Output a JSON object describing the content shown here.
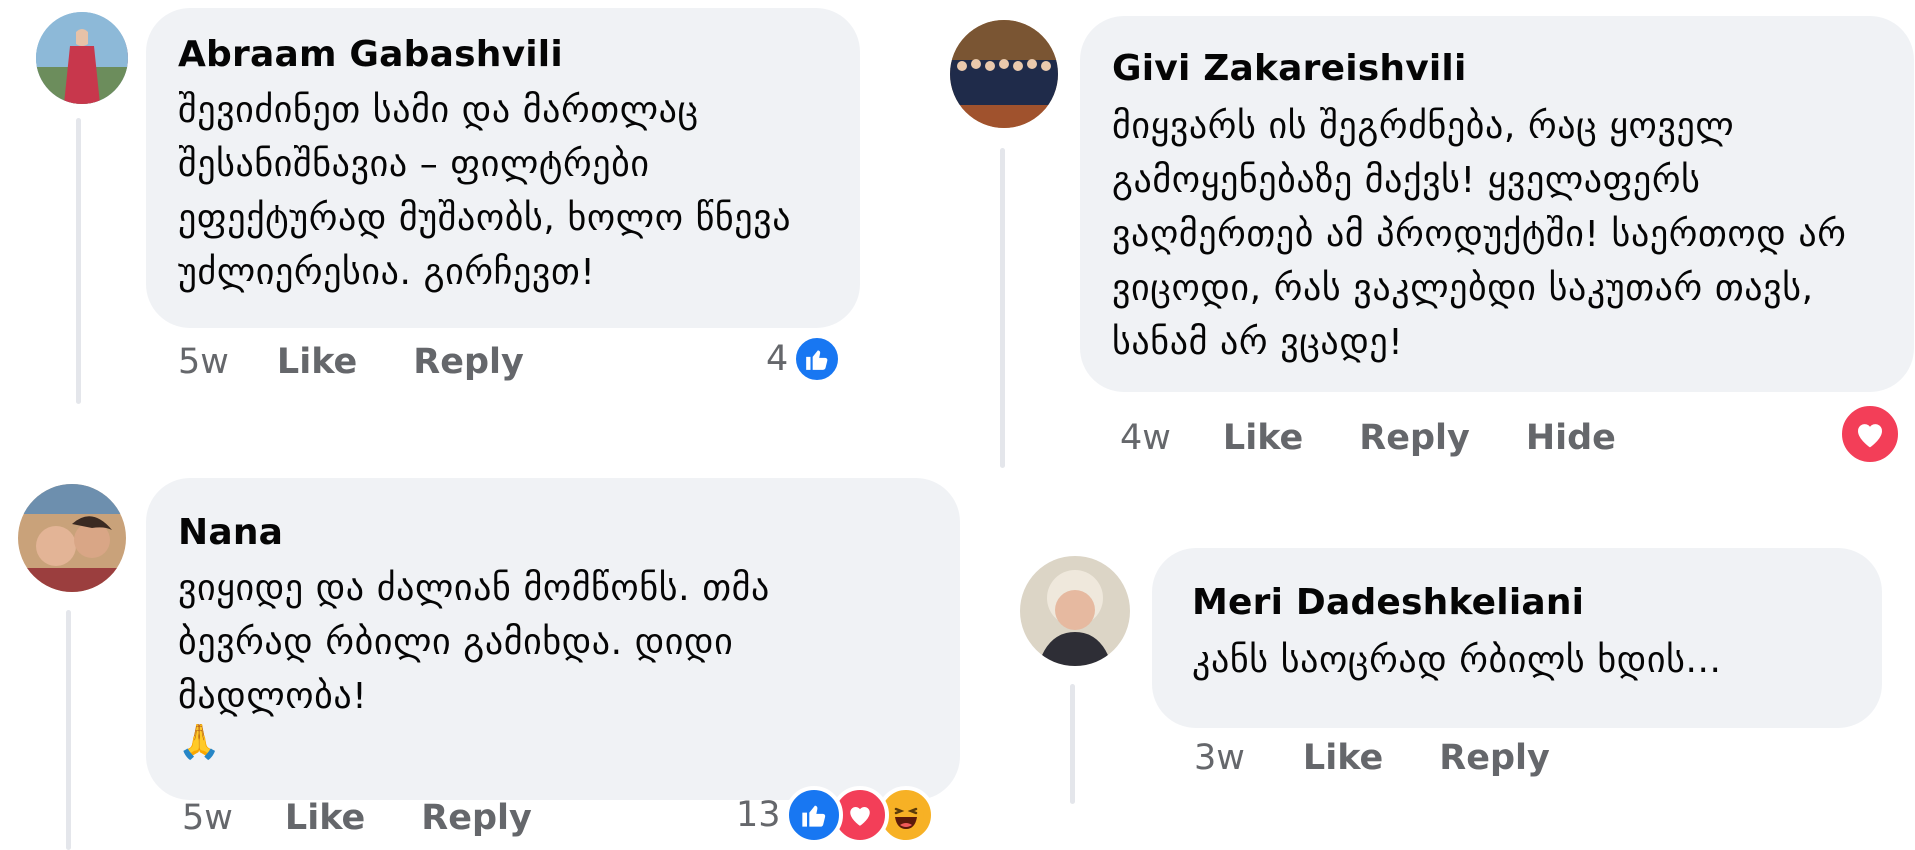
{
  "comments": [
    {
      "author": "Abraam Gabashvili",
      "text": "შევიძინეთ სამი და მართლაც შესანიშნავია – ფილტრები ეფექტურად მუშაობს, ხოლო წნევა უძლიერესია. გირჩევთ!",
      "time": "5w",
      "like_label": "Like",
      "reply_label": "Reply",
      "reaction_count": "4",
      "reactions": [
        "like-icon"
      ]
    },
    {
      "author": "Givi Zakareishvili",
      "text": "მიყვარს ის შეგრძნება, რაც ყოველ გამოყენებაზე მაქვს! ყველაფერს ვაღმერთებ ამ პროდუქტში! საერთოდ არ ვიცოდი, რას ვაკლებდი საკუთარ თავს, სანამ არ ვცადე!",
      "time": "4w",
      "like_label": "Like",
      "reply_label": "Reply",
      "hide_label": "Hide",
      "reactions": [
        "heart-icon"
      ]
    },
    {
      "author": "Nana",
      "text": "ვიყიდე და ძალიან მომწონს. თმა ბევრად რბილი გამიხდა. დიდი მადლობა!",
      "emoji": "🙏",
      "time": "5w",
      "like_label": "Like",
      "reply_label": "Reply",
      "reaction_count": "13",
      "reactions": [
        "like-icon",
        "heart-icon",
        "haha-icon"
      ]
    },
    {
      "author": "Meri Dadeshkeliani",
      "text": "კანს საოცრად რბილს ხდის...",
      "time": "3w",
      "like_label": "Like",
      "reply_label": "Reply"
    }
  ],
  "colors": {
    "bubble": "#f0f2f5",
    "meta_text": "#65676b",
    "like_blue": "#1877f2",
    "love_red": "#f33e58",
    "haha_yellow": "#f7b125"
  }
}
